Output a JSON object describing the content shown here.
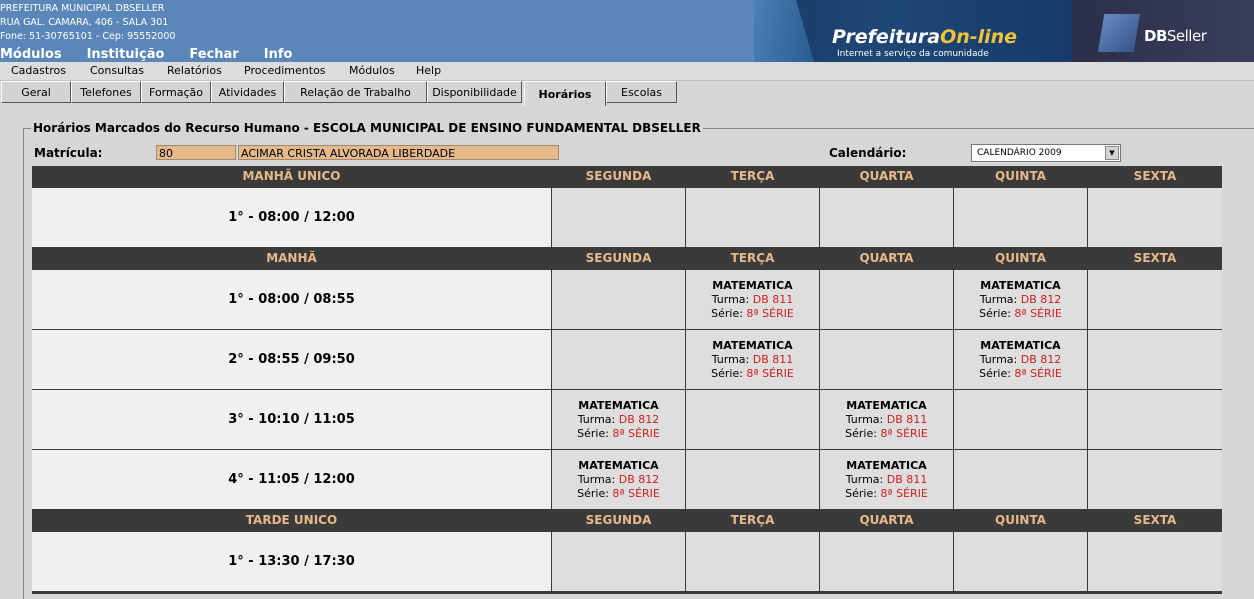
{
  "header": {
    "line1": "PREFEITURA MUNICIPAL DBSELLER",
    "line2": "RUA GAL. CAMARA, 406 - SALA 301",
    "line3": "Fone: 51-30765101  -  Cep: 95552000",
    "menu": [
      "Módulos",
      "Instituição",
      "Fechar",
      "Info"
    ],
    "brand1_a": "Prefeitura",
    "brand1_b": "On-line",
    "brand1_sub": "Internet a serviço da comunidade",
    "brand2_a": "DB",
    "brand2_b": "Seller"
  },
  "menubar": [
    "Cadastros",
    "Consultas",
    "Relatórios",
    "Procedimentos",
    "Módulos",
    "Help"
  ],
  "tabs": [
    "Geral",
    "Telefones",
    "Formação",
    "Atividades",
    "Relação de Trabalho",
    "Disponibilidade",
    "Horários",
    "Escolas"
  ],
  "active_tab": "Horários",
  "form": {
    "legend": "Horários Marcados do Recurso Humano - ESCOLA MUNICIPAL DE ENSINO FUNDAMENTAL DBSELLER",
    "matricula_label": "Matrícula:",
    "matricula_value": "80",
    "nome_value": "ACIMAR CRISTA ALVORADA LIBERDADE",
    "calendario_label": "Calendário:",
    "calendario_value": "CALENDÁRIO 2009"
  },
  "days": [
    "SEGUNDA",
    "TERÇA",
    "QUARTA",
    "QUINTA",
    "SEXTA"
  ],
  "labels": {
    "turma": "Turma:",
    "serie": "Série:"
  },
  "sections": [
    {
      "title": "MANHÃ UNICO",
      "rows": [
        {
          "period": "1° - 08:00 / 12:00",
          "slots": [
            null,
            null,
            null,
            null,
            null
          ]
        }
      ]
    },
    {
      "title": "MANHÃ",
      "rows": [
        {
          "period": "1° - 08:00 / 08:55",
          "slots": [
            null,
            {
              "disc": "MATEMATICA",
              "turma": "DB 811",
              "serie": "8ª SÉRIE"
            },
            null,
            {
              "disc": "MATEMATICA",
              "turma": "DB 812",
              "serie": "8ª SÉRIE"
            },
            null
          ]
        },
        {
          "period": "2° - 08:55 / 09:50",
          "slots": [
            null,
            {
              "disc": "MATEMATICA",
              "turma": "DB 811",
              "serie": "8ª SÉRIE"
            },
            null,
            {
              "disc": "MATEMATICA",
              "turma": "DB 812",
              "serie": "8ª SÉRIE"
            },
            null
          ]
        },
        {
          "period": "3° - 10:10 / 11:05",
          "slots": [
            {
              "disc": "MATEMATICA",
              "turma": "DB 812",
              "serie": "8ª SÉRIE"
            },
            null,
            {
              "disc": "MATEMATICA",
              "turma": "DB 811",
              "serie": "8ª SÉRIE"
            },
            null,
            null
          ]
        },
        {
          "period": "4° - 11:05 / 12:00",
          "slots": [
            {
              "disc": "MATEMATICA",
              "turma": "DB 812",
              "serie": "8ª SÉRIE"
            },
            null,
            {
              "disc": "MATEMATICA",
              "turma": "DB 811",
              "serie": "8ª SÉRIE"
            },
            null,
            null
          ]
        }
      ]
    },
    {
      "title": "TARDE UNICO",
      "rows": [
        {
          "period": "1° - 13:30 / 17:30",
          "slots": [
            null,
            null,
            null,
            null,
            null
          ]
        }
      ]
    }
  ]
}
